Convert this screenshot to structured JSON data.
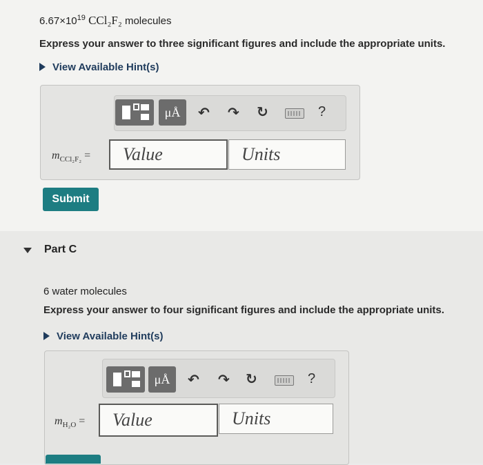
{
  "partB": {
    "question_number": "6.67×10",
    "question_exp": "19",
    "question_species": "CCl₂F₂",
    "question_tail": " molecules",
    "instruction": "Express your answer to three significant figures and include the appropriate units.",
    "hint_label": "View Available Hint(s)",
    "answer_label_main": "m",
    "answer_label_sub": "CCl₂F₂",
    "answer_label_eq": "=",
    "value_placeholder": "Value",
    "units_placeholder": "Units",
    "submit_label": "Submit"
  },
  "partC": {
    "title": "Part C",
    "question": "6 water molecules",
    "instruction": "Express your answer to four significant figures and include the appropriate units.",
    "hint_label": "View Available Hint(s)",
    "answer_label_main": "m",
    "answer_label_sub": "H₂O",
    "answer_label_eq": "=",
    "value_placeholder": "Value",
    "units_placeholder": "Units"
  },
  "toolbar": {
    "mu_label": "μÅ",
    "help_label": "?"
  }
}
